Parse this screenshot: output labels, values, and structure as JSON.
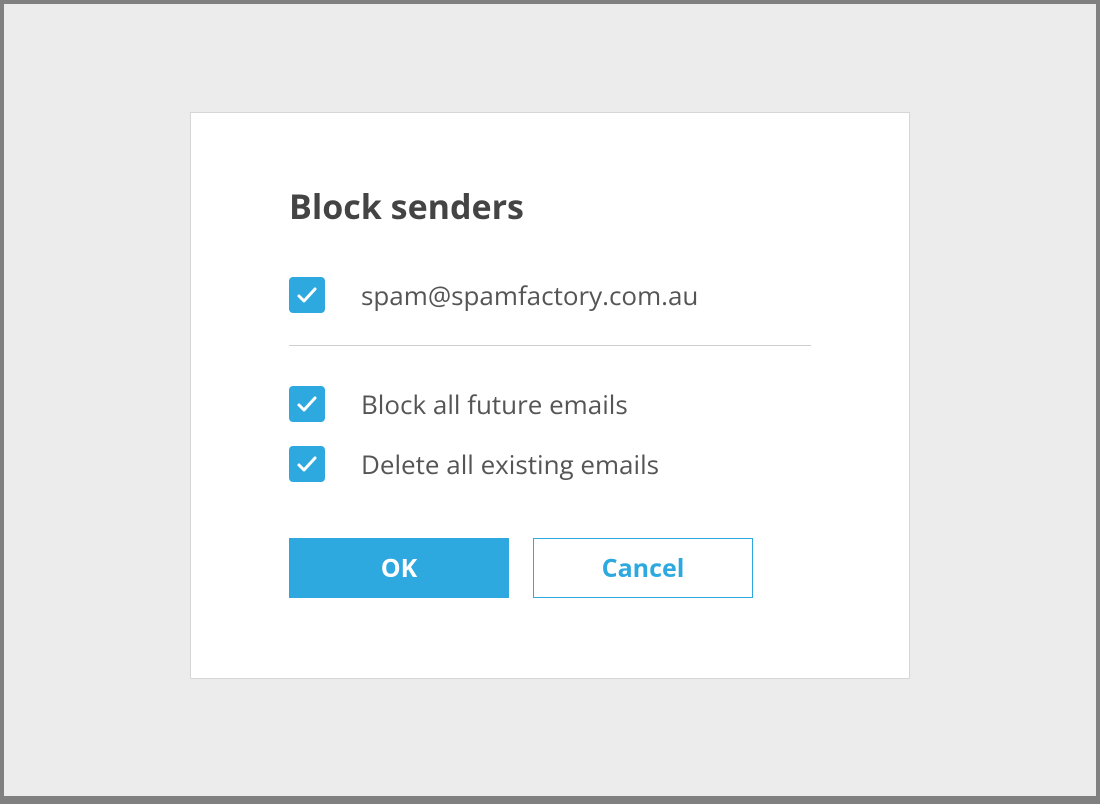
{
  "dialog": {
    "title": "Block senders",
    "sender": {
      "email": "spam@spamfactory.com.au",
      "checked": true
    },
    "options": [
      {
        "label": "Block all future emails",
        "checked": true
      },
      {
        "label": "Delete all existing emails",
        "checked": true
      }
    ],
    "buttons": {
      "ok": "OK",
      "cancel": "Cancel"
    }
  },
  "colors": {
    "accent": "#2ea9df",
    "text": "#555555",
    "title": "#444444",
    "background": "#ececec"
  }
}
